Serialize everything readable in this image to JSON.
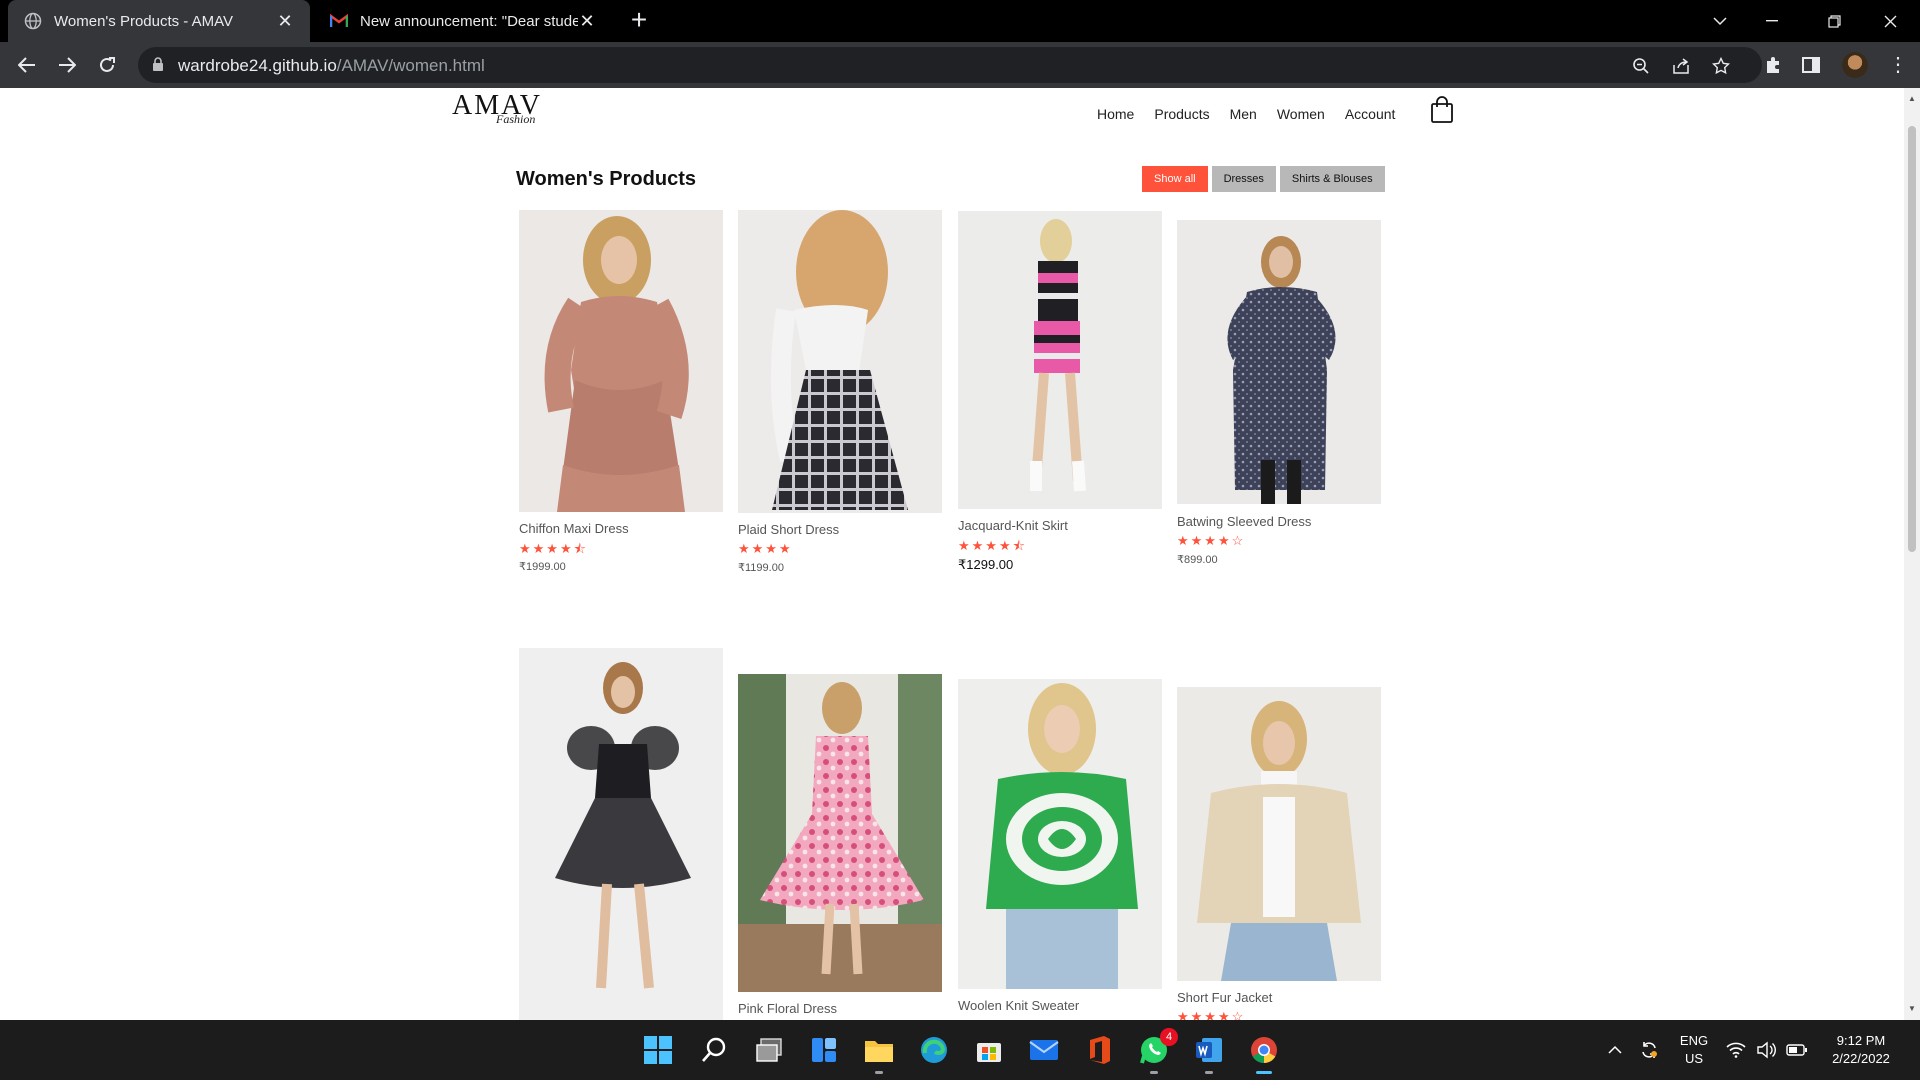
{
  "browser": {
    "tabs": [
      {
        "title": "Women's Products - AMAV",
        "active": true
      },
      {
        "title": "New announcement: \"Dear stude",
        "active": false
      }
    ],
    "url_host": "wardrobe24.github.io",
    "url_path": "/AMAV/women.html"
  },
  "site": {
    "logo_main": "AMAV",
    "logo_sub": "Fashion",
    "nav": [
      "Home",
      "Products",
      "Men",
      "Women",
      "Account"
    ]
  },
  "page": {
    "title": "Women's Products",
    "filters": [
      {
        "label": "Show all",
        "active": true
      },
      {
        "label": "Dresses",
        "active": false
      },
      {
        "label": "Shirts & Blouses",
        "active": false
      }
    ]
  },
  "products": [
    {
      "name": "Chiffon Maxi Dress",
      "stars": "★★★★⯪",
      "price": "₹1999.00",
      "image": "rose-tiered-dress"
    },
    {
      "name": "Plaid Short Dress",
      "stars": "★★★★",
      "price": "₹1199.00",
      "image": "plaid-pinafore-dress"
    },
    {
      "name": "Jacquard-Knit Skirt",
      "stars": "★★★★⯪",
      "price": "₹1299.00",
      "image": "jacquard-knit-set"
    },
    {
      "name": "Batwing Sleeved Dress",
      "stars": "★★★★☆",
      "price": "₹899.00",
      "image": "navy-print-dress"
    },
    {
      "name": "",
      "stars": "",
      "price": "",
      "image": "black-organza-dress"
    },
    {
      "name": "Pink Floral Dress",
      "stars": "",
      "price": "",
      "image": "pink-floral-dress"
    },
    {
      "name": "Woolen Knit Sweater",
      "stars": "",
      "price": "",
      "image": "green-butterfly-sweater"
    },
    {
      "name": "Short Fur Jacket",
      "stars": "★★★★☆",
      "price": "",
      "image": "teddy-jacket"
    }
  ],
  "taskbar": {
    "whatsapp_badge": "4",
    "lang_line1": "ENG",
    "lang_line2": "US",
    "time": "9:12 PM",
    "date": "2/22/2022"
  },
  "colors": {
    "accent": "#ff523b",
    "filter_inactive": "#b8b8b8",
    "chrome_dark": "#35363a"
  }
}
